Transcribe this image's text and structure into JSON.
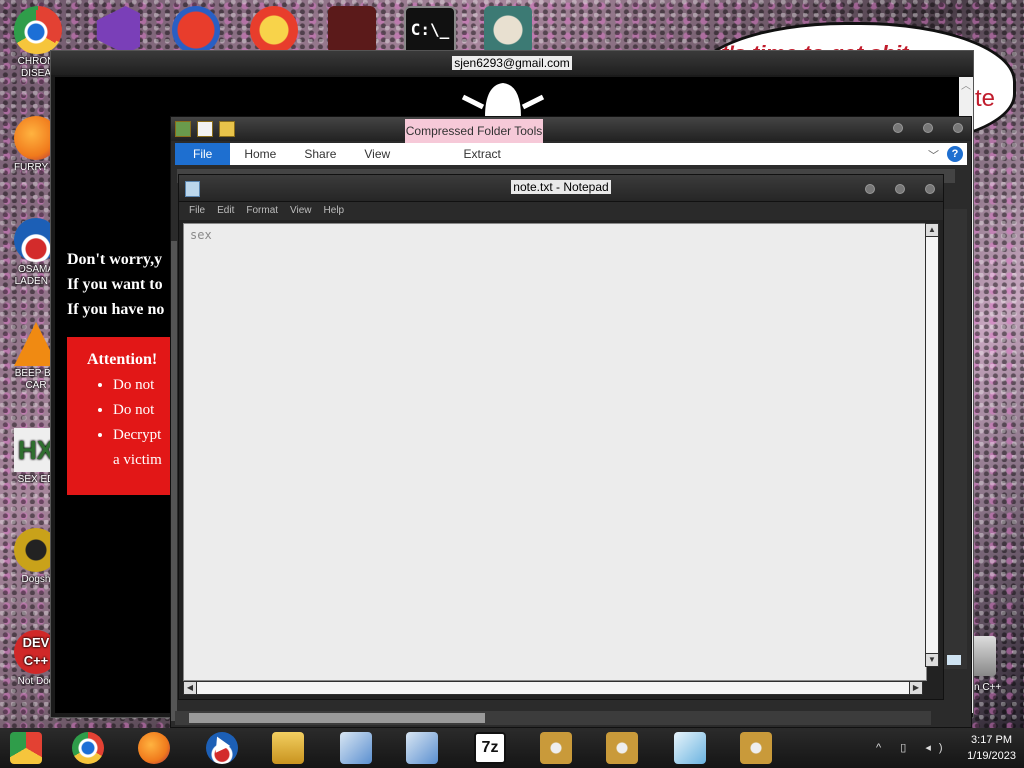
{
  "desktop": {
    "icons": [
      {
        "label": "CHRON",
        "label2": "DISEA",
        "icon": "chrome-icon",
        "color": "#2f9d4a"
      },
      {
        "label": "FURRY C",
        "label2": "",
        "icon": "firefox-icon",
        "color": "#f07a1c"
      },
      {
        "label": "OSAMA",
        "label2": "LADEN B",
        "icon": "obama-logo-icon",
        "color": "#1c5fb6"
      },
      {
        "label": "BEEP BE",
        "label2": "CAR",
        "icon": "vlc-icon",
        "color": "#f08a12"
      },
      {
        "label": "SEX ED",
        "label2": "",
        "icon": "hx-editor-icon",
        "color": "#2f6e2f"
      },
      {
        "label": "Dogsh",
        "label2": "",
        "icon": "dogshit-icon",
        "color": "#c9a21a"
      },
      {
        "label": "Not Dog",
        "label2": "",
        "icon": "devcpp-icon",
        "color": "#d02828"
      }
    ],
    "top_icons": [
      {
        "icon": "visual-studio-icon",
        "color": "#7a3fb8"
      },
      {
        "icon": "numeral-2-icon",
        "color": "#2a5fc4"
      },
      {
        "icon": "p-logo-icon",
        "color": "#e83d2c"
      },
      {
        "icon": "pirate-eye-icon",
        "color": "#8c1a1a"
      },
      {
        "icon": "cmd-icon",
        "color": "#111111"
      },
      {
        "icon": "chef-rat-icon",
        "color": "#3c7a74"
      }
    ],
    "speech_bubble": {
      "line1": "it's time to get shit",
      "line2": "te"
    },
    "right_label": "n C++"
  },
  "ransom_window": {
    "title": "sjen6293@gmail.com",
    "lines": [
      "Don't worry,y",
      "If you want to",
      "If you have no"
    ],
    "attention": {
      "heading": "Attention!",
      "items": [
        "Do not",
        "Do not",
        "Decrypt",
        "a victim"
      ]
    }
  },
  "explorer": {
    "context_tab": "Compressed Folder Tools",
    "tabs": {
      "file": "File",
      "home": "Home",
      "share": "Share",
      "view": "View",
      "extract": "Extract"
    },
    "help": "?"
  },
  "notepad": {
    "title": "note.txt - Notepad",
    "menu": [
      "File",
      "Edit",
      "Format",
      "View",
      "Help"
    ],
    "content": "sex"
  },
  "taskbar": {
    "apps": [
      {
        "icon": "chrome-badge-icon",
        "color": "#2f9d4a"
      },
      {
        "icon": "chrome-icon",
        "color": "#e34133"
      },
      {
        "icon": "firefox-icon",
        "color": "#f07a1c"
      },
      {
        "icon": "obama-logo-icon",
        "color": "#1c5fb6"
      },
      {
        "icon": "file-explorer-icon",
        "color": "#e0b43a"
      },
      {
        "icon": "installer-icon",
        "color": "#5a8fd0"
      },
      {
        "icon": "installer-icon",
        "color": "#5a8fd0"
      },
      {
        "icon": "7zip-icon",
        "color": "#111111",
        "text": "7z"
      },
      {
        "icon": "cd-archive-icon",
        "color": "#c99a3a"
      },
      {
        "icon": "cd-archive-icon",
        "color": "#c99a3a"
      },
      {
        "icon": "editor-icon",
        "color": "#6ab3e0"
      },
      {
        "icon": "cd-archive-icon",
        "color": "#c99a3a"
      }
    ],
    "time": "3:17 PM",
    "date": "1/19/2023",
    "tray_glyphs": "^ ▯ ◂)"
  }
}
